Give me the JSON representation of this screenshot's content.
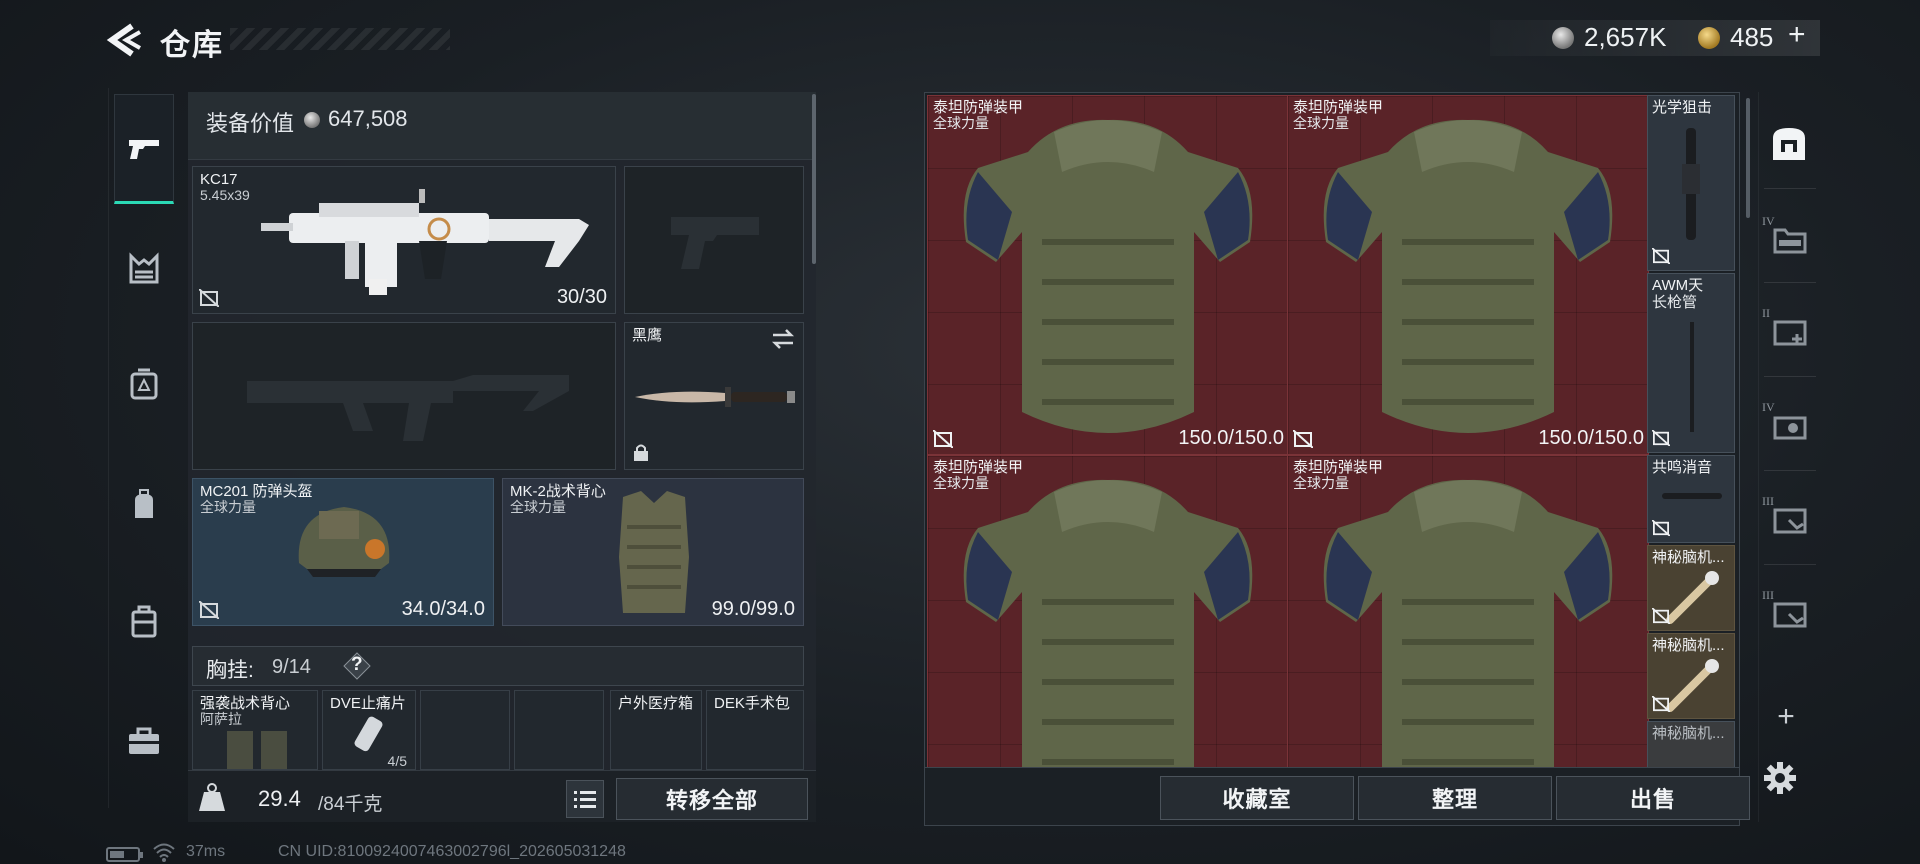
{
  "header": {
    "title": "仓库",
    "silver_amount": "2,657K",
    "gold_amount": "485",
    "plus_label": "+"
  },
  "equipment": {
    "value_label": "装备价值",
    "value": "647,508",
    "primary_weapon": {
      "name": "KC17",
      "caliber": "5.45x39",
      "durability": "30/30"
    },
    "melee": {
      "name": "黑鹰"
    },
    "helmet": {
      "name": "MC201 防弹头盔",
      "faction": "全球力量",
      "durability": "34.0/34.0"
    },
    "vest": {
      "name": "MK-2战术背心",
      "faction": "全球力量",
      "durability": "99.0/99.0"
    },
    "chest_rig": {
      "label": "胸挂:",
      "count": "9/14",
      "help": "?"
    },
    "rig_items": [
      {
        "name": "强袭战术背心",
        "sub": "阿萨拉"
      },
      {
        "name": "DVE止痛片",
        "sub": "4/5"
      },
      {
        "name": "",
        "sub": ""
      },
      {
        "name": "",
        "sub": ""
      },
      {
        "name": "户外医疗箱",
        "sub": ""
      },
      {
        "name": "DEK手术包",
        "sub": ""
      }
    ],
    "weight": {
      "current": "29.4",
      "max": "/84千克"
    },
    "transfer_all": "转移全部"
  },
  "storage": {
    "armor_items": [
      {
        "name": "泰坦防弹装甲",
        "faction": "全球力量",
        "durability": "150.0/150.0"
      },
      {
        "name": "泰坦防弹装甲",
        "faction": "全球力量",
        "durability": "150.0/150.0"
      },
      {
        "name": "泰坦防弹装甲",
        "faction": "全球力量",
        "durability": ""
      },
      {
        "name": "泰坦防弹装甲",
        "faction": "全球力量",
        "durability": ""
      }
    ],
    "side_items": [
      {
        "name": "光学狙击",
        "sub": ""
      },
      {
        "name": "AWM天",
        "sub": "长枪管"
      },
      {
        "name": "共鸣消音",
        "sub": ""
      },
      {
        "name": "神秘脑机...",
        "sub": ""
      },
      {
        "name": "神秘脑机...",
        "sub": ""
      },
      {
        "name": "神秘脑机...",
        "sub": ""
      }
    ],
    "buttons": {
      "collection": "收藏室",
      "sort": "整理",
      "sell": "出售"
    },
    "tab_labels": [
      "IV",
      "II",
      "IV",
      "III",
      "III"
    ],
    "add_label": "+"
  },
  "status": {
    "ping": "37ms",
    "uid": "CN UID:8100924007463002796l_202605031248"
  },
  "colors": {
    "accent": "#2bd9b5",
    "armor_cell": "#5a2328",
    "helmet_slot": "#2a3d4d",
    "gold_cell": "#4a4232"
  }
}
